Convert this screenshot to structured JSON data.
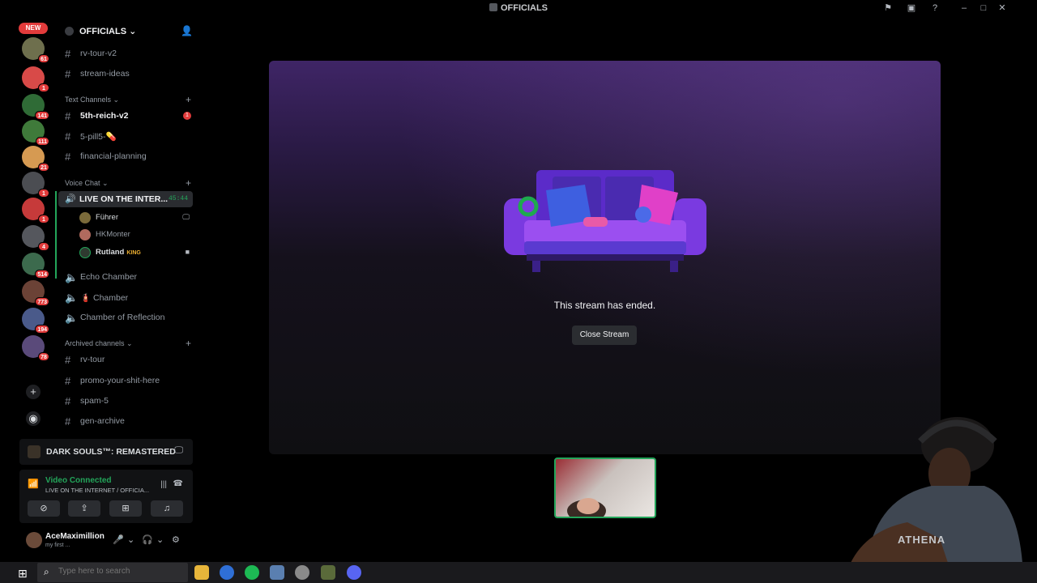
{
  "window": {
    "title": "OFFICIALS"
  },
  "rail": {
    "new_label": "NEW",
    "servers": [
      {
        "count": "61",
        "color": "#6e6f4d"
      },
      {
        "count": "1",
        "color": "#d84a48"
      },
      {
        "count": "141",
        "color": "#2f6b36"
      },
      {
        "count": "111",
        "color": "#3f7a3a"
      },
      {
        "count": "21",
        "color": "#d69a52"
      },
      {
        "count": "1",
        "color": "#4b4d52"
      },
      {
        "count": "1",
        "color": "#c63a3a"
      },
      {
        "count": "4",
        "color": "#55575d"
      },
      {
        "count": "514",
        "color": "#3c6a4d"
      },
      {
        "count": "773",
        "color": "#6b4236"
      },
      {
        "count": "194",
        "color": "#4a5a8a"
      },
      {
        "count": "78",
        "color": "#5a4a7a"
      }
    ]
  },
  "sidebar": {
    "server_name": "OFFICIALS",
    "top_channels": [
      "rv-tour-v2",
      "stream-ideas"
    ],
    "categories": {
      "text": "Text Channels",
      "voice": "Voice Chat",
      "archived": "Archived channels"
    },
    "text_channels": [
      {
        "name": "5th-reich-v2",
        "badge": "1"
      },
      {
        "name": "5-pill5-💊"
      },
      {
        "name": "financial-planning"
      }
    ],
    "voice_live": {
      "name": "LIVE ON THE INTER...",
      "time": "45:44"
    },
    "voice_users": [
      {
        "name": "Führer"
      },
      {
        "name": "HKMonter"
      },
      {
        "name": "Rutland",
        "tag": "KING"
      }
    ],
    "voice_channels": [
      "Echo Chamber",
      "🧯 Chamber",
      "Chamber of Reflection"
    ],
    "archived_channels": [
      "rv-tour",
      "promo-your-shit-here",
      "spam-5",
      "gen-archive"
    ]
  },
  "activity": {
    "game": "DARK SOULS™: REMASTERED"
  },
  "voice_panel": {
    "status": "Video Connected",
    "location": "LIVE ON THE INTERNET / OFFICIA..."
  },
  "user": {
    "name": "AceMaximillion",
    "status": "my first ..."
  },
  "stage": {
    "message": "This stream has ended.",
    "close_label": "Close Stream"
  },
  "webcam": {
    "shirt_text": "ATHENA"
  },
  "taskbar": {
    "search_placeholder": "Type here to search"
  }
}
